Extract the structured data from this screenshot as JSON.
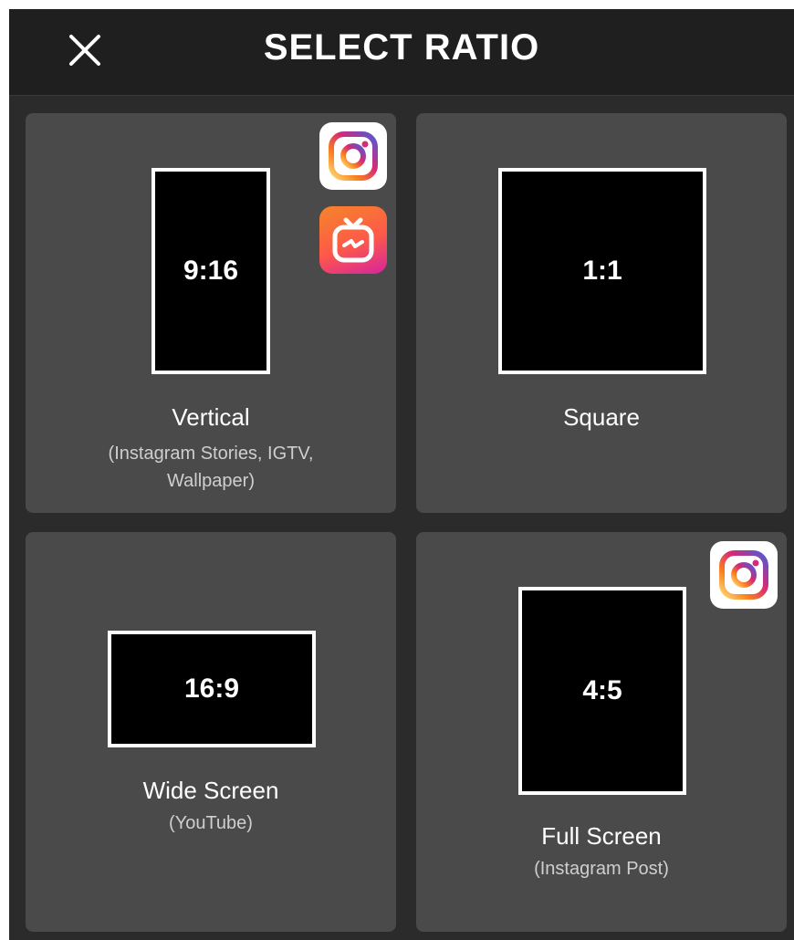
{
  "header": {
    "title": "SELECT RATIO",
    "close_icon": "close-icon"
  },
  "options": [
    {
      "ratio": "9:16",
      "title": "Vertical",
      "subtitle_line1": "(Instagram Stories, IGTV,",
      "subtitle_line2": "Wallpaper)",
      "badges": [
        "instagram-icon",
        "igtv-icon"
      ]
    },
    {
      "ratio": "1:1",
      "title": "Square",
      "badges": []
    },
    {
      "ratio": "16:9",
      "title": "Wide Screen",
      "subtitle_line1": "(YouTube)",
      "badges": []
    },
    {
      "ratio": "4:5",
      "title": "Full Screen",
      "subtitle_line1": "(Instagram Post)",
      "badges": [
        "instagram-icon"
      ]
    }
  ],
  "colors": {
    "background": "#2b2b2b",
    "header": "#1f1f1f",
    "card": "#4a4a4a",
    "frame": "#000000",
    "frame_border": "#ffffff"
  }
}
